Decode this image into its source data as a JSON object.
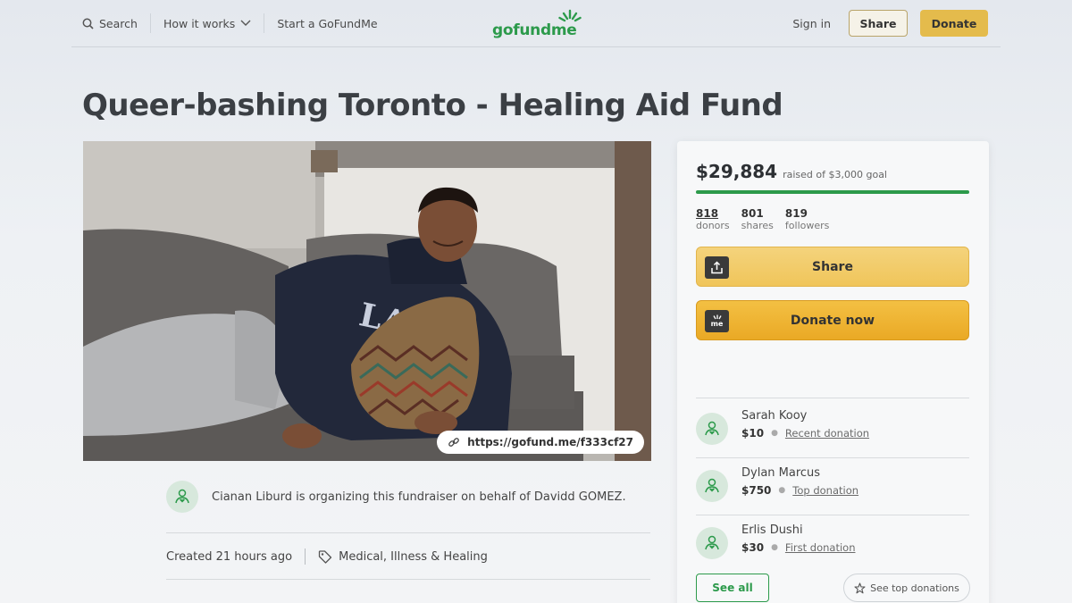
{
  "nav": {
    "search_label": "Search",
    "how_it_works_label": "How it works",
    "start_label": "Start a GoFundMe",
    "logo_text": "gofundme",
    "signin_label": "Sign in",
    "share_label": "Share",
    "donate_label": "Donate"
  },
  "campaign": {
    "title": "Queer-bashing Toronto - Healing Aid Fund",
    "short_url": "https://gofund.me/f333cf27",
    "organizer_text": "Cianan Liburd is organizing this fundraiser on behalf of Davidd GOMEZ.",
    "created": "Created 21 hours ago",
    "category": "Medical, Illness & Healing"
  },
  "sidebar": {
    "amount_raised": "$29,884",
    "goal_text": "raised of $3,000 goal",
    "progress_fraction": 1.0,
    "stats": [
      {
        "value": "818",
        "label": "donors"
      },
      {
        "value": "801",
        "label": "shares"
      },
      {
        "value": "819",
        "label": "followers"
      }
    ],
    "share_button": "Share",
    "donate_button": "Donate now",
    "donate_icon_text": "me",
    "donations": [
      {
        "name": "Sarah Kooy",
        "amount": "$10",
        "kind": "Recent donation"
      },
      {
        "name": "Dylan Marcus",
        "amount": "$750",
        "kind": "Top donation"
      },
      {
        "name": "Erlis Dushi",
        "amount": "$30",
        "kind": "First donation"
      }
    ],
    "see_all": "See all",
    "see_top": "See top donations"
  },
  "colors": {
    "brand_green": "#2c9a4b",
    "donate_yellow": "#e4bb4c",
    "donate_orange": "#eaa925"
  }
}
